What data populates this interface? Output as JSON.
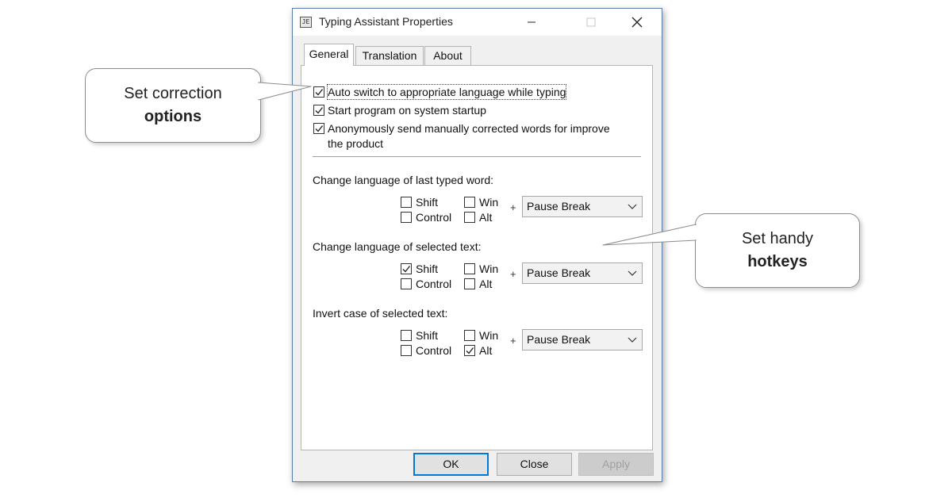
{
  "window": {
    "title": "Typing Assistant Properties",
    "icon_text": "JE"
  },
  "tabs": [
    {
      "label": "General",
      "active": true
    },
    {
      "label": "Translation",
      "active": false
    },
    {
      "label": "About",
      "active": false
    }
  ],
  "options": [
    {
      "label": "Auto switch to appropriate language while typing",
      "checked": true
    },
    {
      "label": "Start program on system startup",
      "checked": true
    },
    {
      "label_line1": "Anonymously send manually corrected words for improve",
      "label_line2": "the product",
      "checked": true
    }
  ],
  "hotkey_groups": [
    {
      "title": "Change language of last typed word:",
      "shift": {
        "label": "Shift",
        "checked": false
      },
      "win": {
        "label": "Win",
        "checked": false
      },
      "control": {
        "label": "Control",
        "checked": false
      },
      "alt": {
        "label": "Alt",
        "checked": false
      },
      "plus": "+",
      "key": "Pause Break"
    },
    {
      "title": "Change language of selected text:",
      "shift": {
        "label": "Shift",
        "checked": true
      },
      "win": {
        "label": "Win",
        "checked": false
      },
      "control": {
        "label": "Control",
        "checked": false
      },
      "alt": {
        "label": "Alt",
        "checked": false
      },
      "plus": "+",
      "key": "Pause Break"
    },
    {
      "title": "Invert case of selected text:",
      "shift": {
        "label": "Shift",
        "checked": false
      },
      "win": {
        "label": "Win",
        "checked": false
      },
      "control": {
        "label": "Control",
        "checked": false
      },
      "alt": {
        "label": "Alt",
        "checked": true
      },
      "plus": "+",
      "key": "Pause Break"
    }
  ],
  "buttons": {
    "ok": "OK",
    "close": "Close",
    "apply": "Apply"
  },
  "callouts": {
    "left": {
      "line1": "Set correction",
      "line2": "options"
    },
    "right": {
      "line1": "Set handy",
      "line2": "hotkeys"
    }
  },
  "colors": {
    "accent": "#0078d7",
    "window_border": "#5a7fa8",
    "panel_bg": "#ffffff",
    "dialog_bg": "#f0f0f0"
  },
  "icons": {
    "app": "app-logo-icon",
    "minimize": "minimize-icon",
    "maximize": "maximize-icon",
    "close": "close-icon",
    "dropdown": "chevron-down-icon",
    "check": "check-icon"
  }
}
